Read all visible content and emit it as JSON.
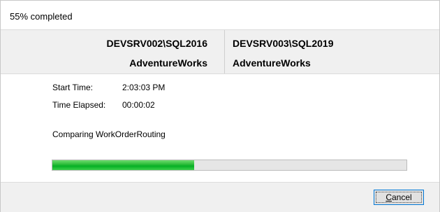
{
  "window": {
    "title": "55% completed"
  },
  "header": {
    "left": {
      "server": "DEVSRV002\\SQL2016",
      "database": "AdventureWorks"
    },
    "right": {
      "server": "DEVSRV003\\SQL2019",
      "database": "AdventureWorks"
    }
  },
  "info": {
    "start_time_label": "Start Time:",
    "start_time_value": "2:03:03 PM",
    "elapsed_label": "Time Elapsed:",
    "elapsed_value": "00:00:02"
  },
  "status": {
    "text": "Comparing WorkOrderRouting"
  },
  "progress": {
    "fraction": 0.4,
    "color": "#06b025"
  },
  "footer": {
    "cancel_mnemonic": "C",
    "cancel_rest": "ancel"
  }
}
